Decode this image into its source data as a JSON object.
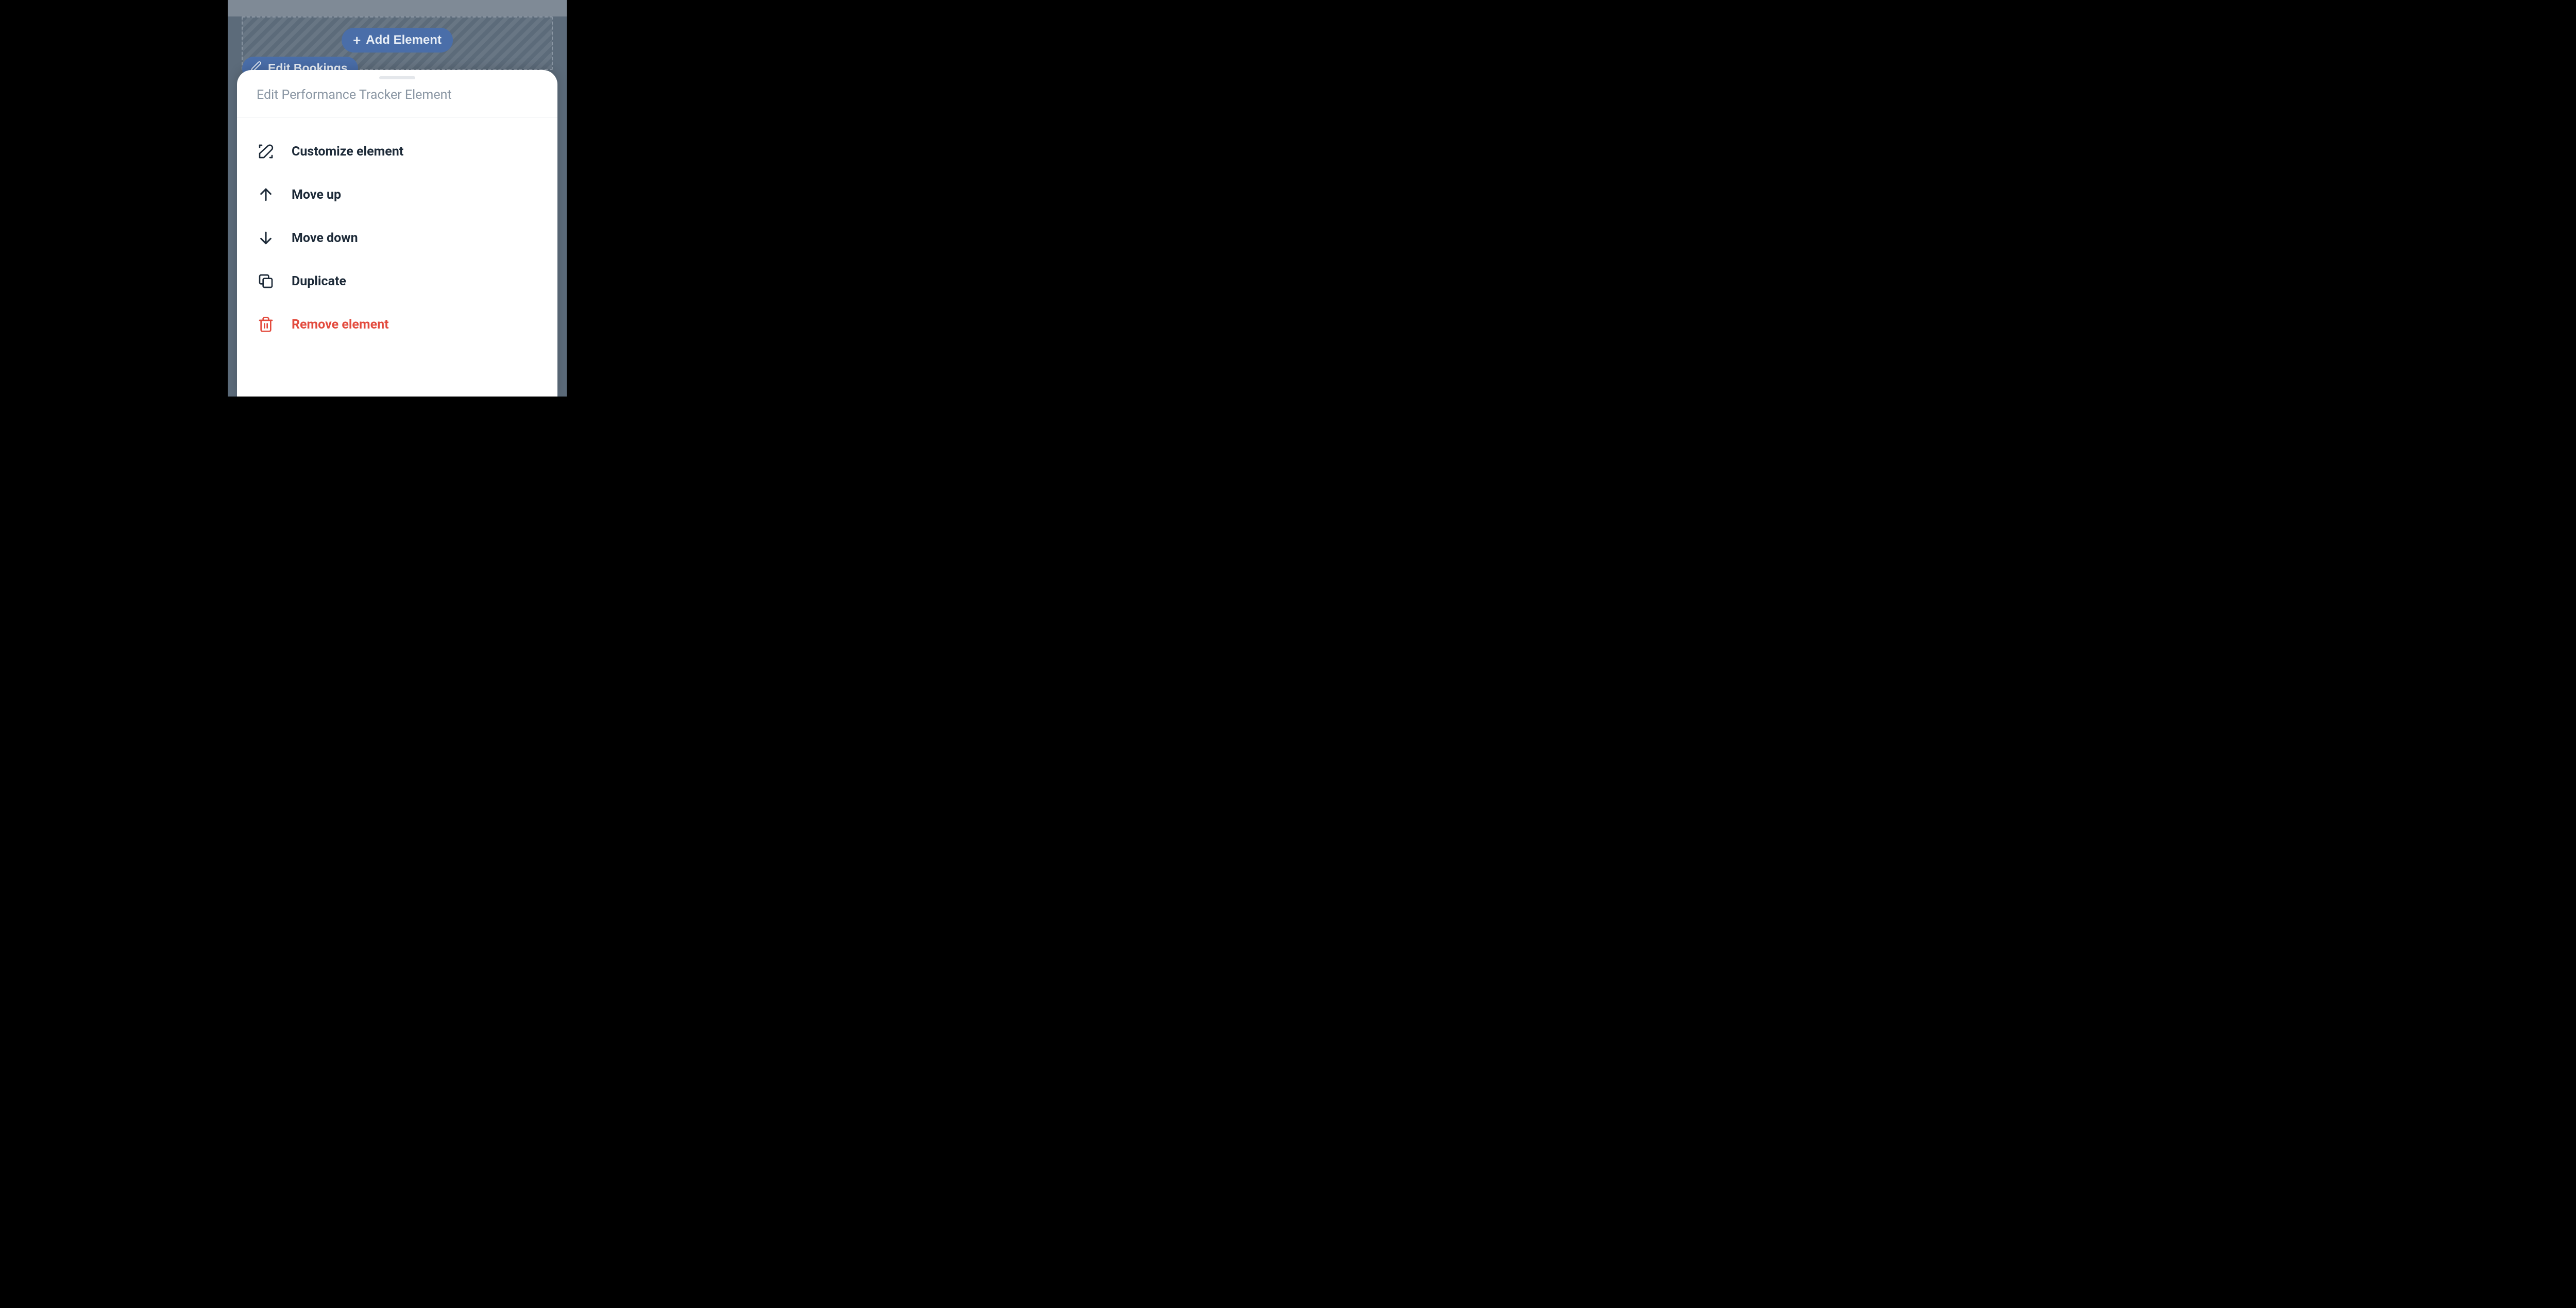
{
  "toolbar": {
    "add_element_label": "Add Element",
    "edit_bookings_label": "Edit Bookings"
  },
  "sheet": {
    "title": "Edit Performance Tracker Element",
    "items": [
      {
        "label": "Customize element"
      },
      {
        "label": "Move up"
      },
      {
        "label": "Move down"
      },
      {
        "label": "Duplicate"
      },
      {
        "label": "Remove element"
      }
    ]
  }
}
